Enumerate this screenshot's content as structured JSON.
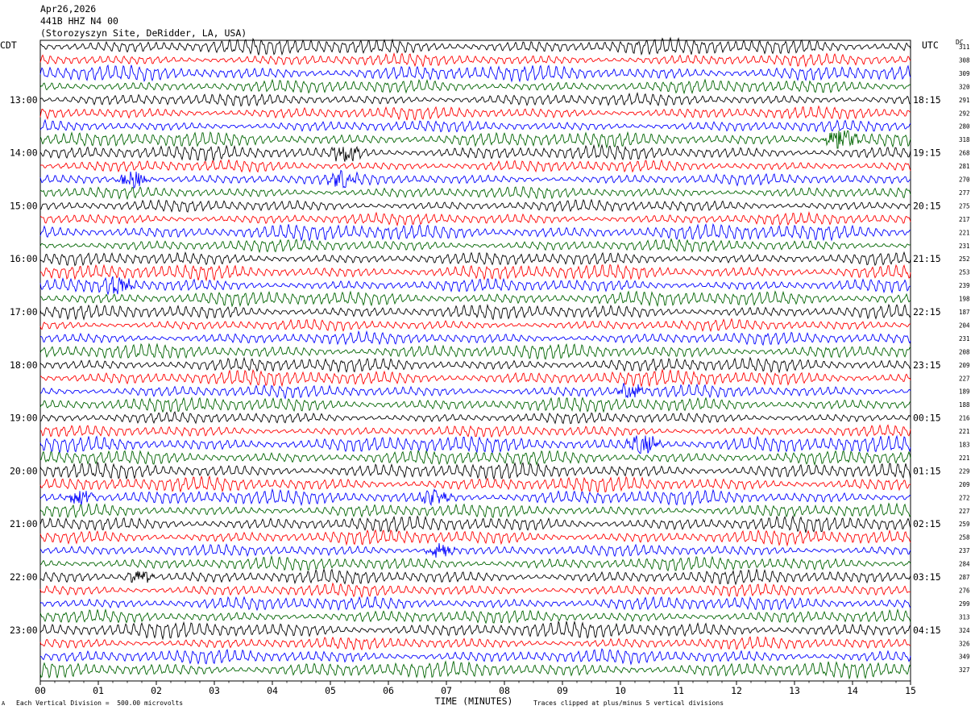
{
  "header": {
    "date": "Apr26,2026",
    "channel": "441B HHZ N4 00",
    "site": "(Storozyszyn Site, DeRidder, LA, USA)"
  },
  "left_zone": "CDT",
  "right_zone": "UTC",
  "dc_label": "DC",
  "x_axis_title": "TIME (MINUTES)",
  "footer_left": "Each Vertical Division =  500.00 microvolts",
  "footer_right": "Traces clipped at plus/minus 5 vertical divisions",
  "footer_mark": "A",
  "colors": {
    "trace_cycle": [
      "#000000",
      "#ff0000",
      "#0000ff",
      "#006400"
    ],
    "axis": "#000000",
    "background": "#ffffff"
  },
  "chart_data": {
    "type": "line",
    "title": "441B HHZ N4 00",
    "xlabel": "TIME (MINUTES)",
    "ylabel": "",
    "xlim": [
      0,
      15
    ],
    "x_ticks": [
      "00",
      "01",
      "02",
      "03",
      "04",
      "05",
      "06",
      "07",
      "08",
      "09",
      "10",
      "11",
      "12",
      "13",
      "14",
      "15"
    ],
    "left_time_labels": [
      "13:00",
      "14:00",
      "15:00",
      "16:00",
      "17:00",
      "18:00",
      "19:00",
      "20:00",
      "21:00",
      "22:00",
      "23:00"
    ],
    "right_time_labels": [
      "18:15",
      "19:15",
      "20:15",
      "21:15",
      "22:15",
      "23:15",
      "00:15",
      "01:15",
      "02:15",
      "03:15",
      "04:15"
    ],
    "traces_per_hour": 4,
    "trace_count": 48,
    "dc_offsets": [
      311,
      308,
      309,
      320,
      291,
      292,
      280,
      318,
      268,
      281,
      270,
      277,
      275,
      217,
      221,
      231,
      252,
      253,
      239,
      198,
      187,
      204,
      231,
      208,
      209,
      227,
      189,
      188,
      216,
      221,
      183,
      221,
      229,
      209,
      272,
      227,
      259,
      258,
      237,
      284,
      287,
      276,
      299,
      313,
      324,
      326,
      349,
      327
    ],
    "events": [
      {
        "trace": 7,
        "minute": 13.8,
        "amp": 2.6
      },
      {
        "trace": 8,
        "minute": 5.25,
        "amp": 2.0
      },
      {
        "trace": 10,
        "minute": 1.6,
        "amp": 1.8
      },
      {
        "trace": 10,
        "minute": 5.2,
        "amp": 1.6
      },
      {
        "trace": 18,
        "minute": 1.3,
        "amp": 2.3
      },
      {
        "trace": 26,
        "minute": 10.2,
        "amp": 1.5
      },
      {
        "trace": 30,
        "minute": 10.4,
        "amp": 2.1
      },
      {
        "trace": 34,
        "minute": 0.7,
        "amp": 1.8
      },
      {
        "trace": 34,
        "minute": 6.8,
        "amp": 1.6
      },
      {
        "trace": 38,
        "minute": 6.9,
        "amp": 1.6
      },
      {
        "trace": 40,
        "minute": 1.7,
        "amp": 1.5
      }
    ]
  }
}
